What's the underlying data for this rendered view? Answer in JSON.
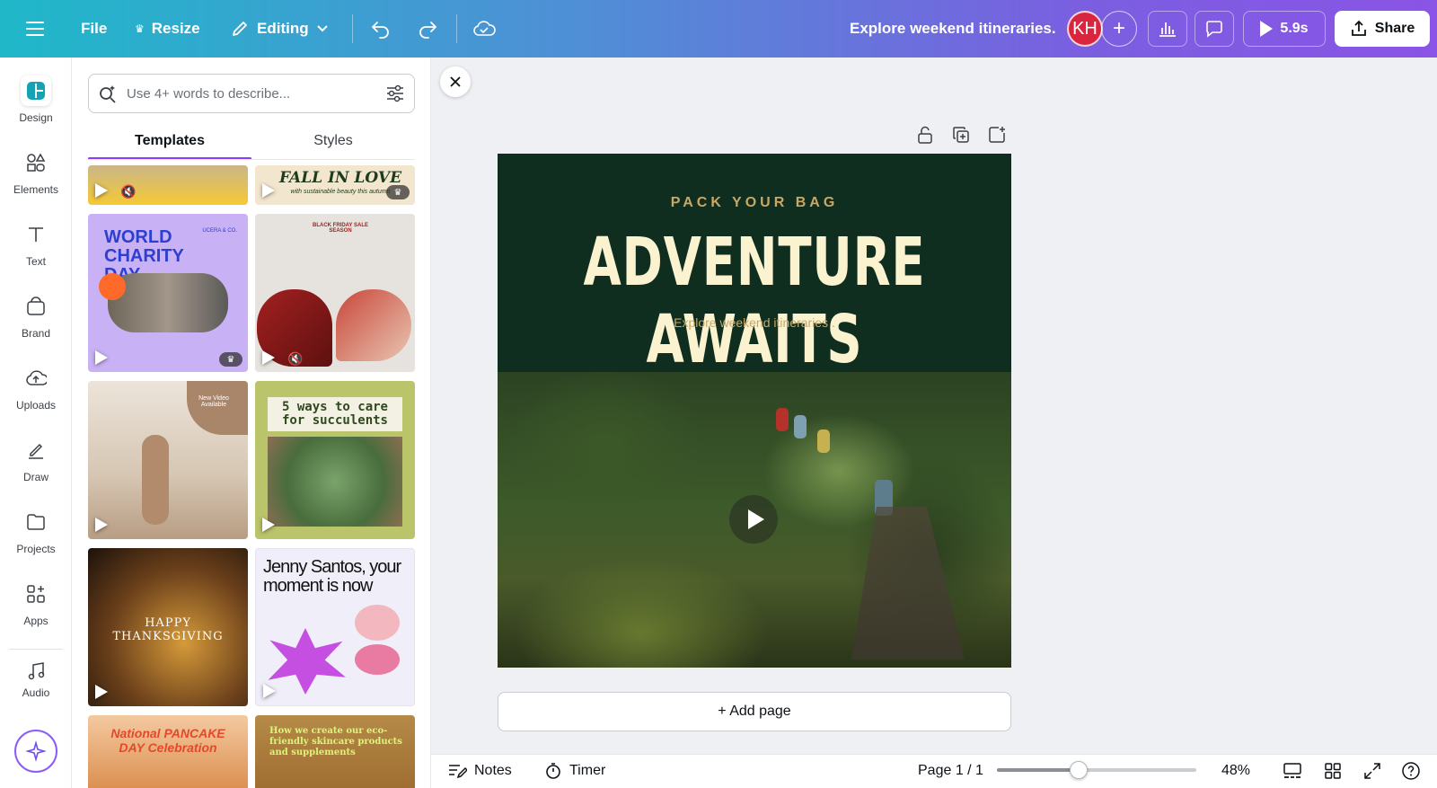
{
  "topbar": {
    "file_label": "File",
    "resize_label": "Resize",
    "editing_label": "Editing",
    "doc_title": "Explore weekend itineraries.",
    "avatar_initials": "KH",
    "play_duration": "5.9s",
    "share_label": "Share"
  },
  "rail": {
    "items": [
      {
        "label": "Design",
        "icon": "design-icon"
      },
      {
        "label": "Elements",
        "icon": "elements-icon"
      },
      {
        "label": "Text",
        "icon": "text-icon"
      },
      {
        "label": "Brand",
        "icon": "brand-icon"
      },
      {
        "label": "Uploads",
        "icon": "uploads-icon"
      },
      {
        "label": "Draw",
        "icon": "draw-icon"
      },
      {
        "label": "Projects",
        "icon": "projects-icon"
      },
      {
        "label": "Apps",
        "icon": "apps-icon"
      },
      {
        "label": "Audio",
        "icon": "music-icon"
      }
    ]
  },
  "panel": {
    "search_placeholder": "Use 4+ words to describe...",
    "tabs": [
      {
        "label": "Templates",
        "active": true
      },
      {
        "label": "Styles",
        "active": false
      }
    ],
    "templates": [
      {
        "text": "",
        "premium": false
      },
      {
        "text": "FALL IN LOVE",
        "subtext": "with sustainable beauty this autumn",
        "premium": true
      },
      {
        "text": "WORLD CHARITY DAY",
        "subtext": "UCERA & CO.",
        "premium": true
      },
      {
        "text": "BLACK FRIDAY SALE SEASON",
        "premium": false
      },
      {
        "text": "New Video Available",
        "premium": false
      },
      {
        "text": "5 ways to care for succulents",
        "premium": false
      },
      {
        "text": "HAPPY THANKSGIVING",
        "premium": false
      },
      {
        "text": "Jenny Santos, your moment is now",
        "premium": false
      },
      {
        "text": "National PANCAKE DAY Celebration",
        "premium": false
      },
      {
        "text": "How we create our eco-friendly skincare products and supplements",
        "premium": false
      }
    ]
  },
  "design": {
    "kicker": "PACK YOUR BAG",
    "title": "ADVENTURE AWAITS",
    "subtitle": "Explore weekend itineraries ."
  },
  "canvas": {
    "add_page_label": "+ Add page"
  },
  "bottombar": {
    "notes_label": "Notes",
    "timer_label": "Timer",
    "page_indicator": "Page 1 / 1",
    "zoom": "48%",
    "zoom_fraction": 0.41
  },
  "colors": {
    "accent": "#8b3dff",
    "design_bg": "#0f2e1f",
    "title": "#fbf3d0",
    "gold": "#c9a865",
    "avatar": "#d9253d"
  }
}
